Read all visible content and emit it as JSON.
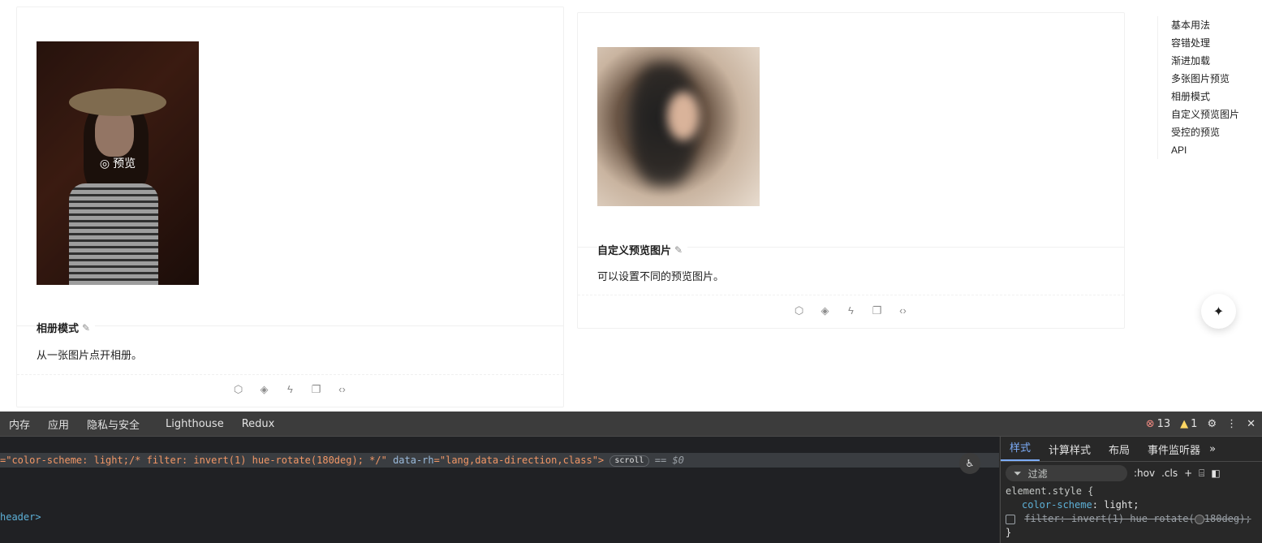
{
  "left_card": {
    "preview_label": "预览",
    "title": "相册模式",
    "description": "从一张图片点开相册。"
  },
  "right_card": {
    "title": "自定义预览图片",
    "description": "可以设置不同的预览图片。"
  },
  "anchor_nav": {
    "items": [
      "基本用法",
      "容错处理",
      "渐进加载",
      "多张图片预览",
      "相册模式",
      "自定义预览图片",
      "受控的预览",
      "API"
    ]
  },
  "devtools": {
    "tabs": [
      "内存",
      "应用",
      "隐私与安全",
      "Lighthouse",
      "Redux"
    ],
    "error_count": "13",
    "warning_count": "1",
    "elements": {
      "selected_attr_value": "=\"color-scheme: light;/* filter: invert(1) hue-rotate(180deg); */\"",
      "attr_name": "data-rh",
      "attr_value": "=\"lang,data-direction,class\">",
      "badge": "scroll",
      "equals": "==",
      "dollar": "$0",
      "header_close": "header>"
    },
    "styles_tabs": [
      "样式",
      "计算样式",
      "布局",
      "事件监听器"
    ],
    "filter_placeholder": "过滤",
    "hov": ":hov",
    "cls": ".cls",
    "code": {
      "selector": "element.style {",
      "prop1": "color-scheme",
      "val1": ": light;",
      "prop2": "filter",
      "val2": ": invert(1) hue-rotate(",
      "val2b": "180deg);",
      "close": "}"
    }
  }
}
